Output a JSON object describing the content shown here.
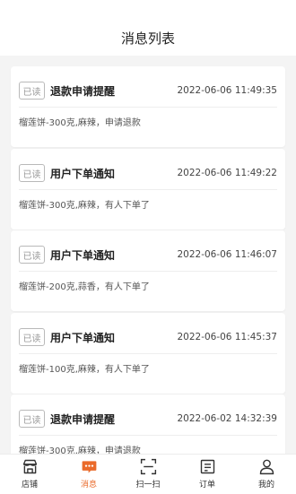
{
  "header": {
    "title": "消息列表"
  },
  "messages": [
    {
      "badge": "已读",
      "title": "退款申请提醒",
      "time": "2022-06-06 11:49:35",
      "desc": "榴莲饼-300克,麻辣，申请退款"
    },
    {
      "badge": "已读",
      "title": "用户下单通知",
      "time": "2022-06-06 11:49:22",
      "desc": "榴莲饼-300克,麻辣，有人下单了"
    },
    {
      "badge": "已读",
      "title": "用户下单通知",
      "time": "2022-06-06 11:46:07",
      "desc": "榴莲饼-200克,蒜香，有人下单了"
    },
    {
      "badge": "已读",
      "title": "用户下单通知",
      "time": "2022-06-06 11:45:37",
      "desc": "榴莲饼-100克,麻辣，有人下单了"
    },
    {
      "badge": "已读",
      "title": "退款申请提醒",
      "time": "2022-06-02 14:32:39",
      "desc": "榴莲饼-300克,麻辣，申请退款"
    }
  ],
  "tabbar": {
    "active_color": "#ea6a2a",
    "items": [
      {
        "label": "店铺",
        "icon": "store-icon"
      },
      {
        "label": "消息",
        "icon": "message-icon"
      },
      {
        "label": "扫一扫",
        "icon": "scan-icon"
      },
      {
        "label": "订单",
        "icon": "order-icon"
      },
      {
        "label": "我的",
        "icon": "user-icon"
      }
    ]
  }
}
